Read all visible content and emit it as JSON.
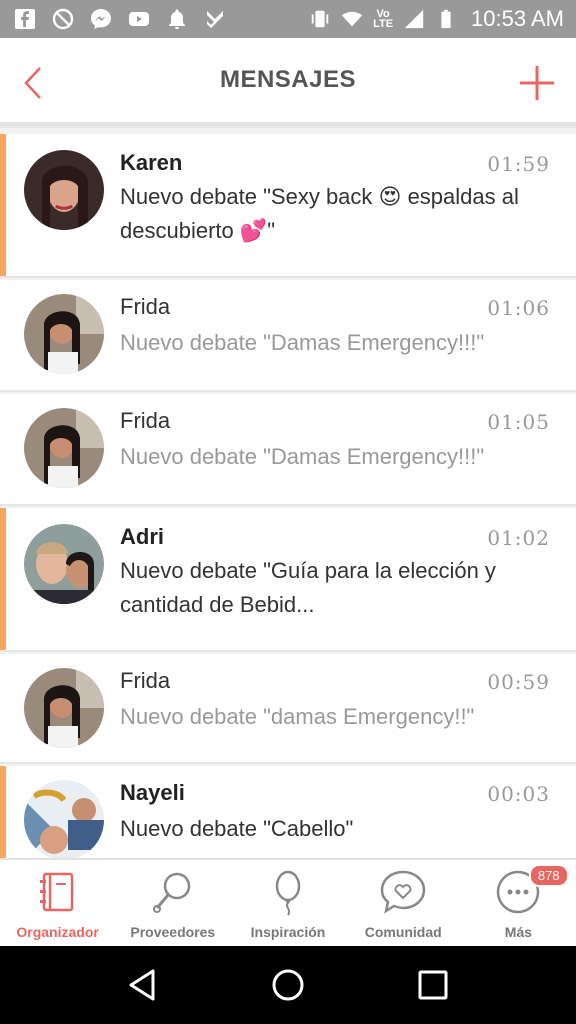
{
  "status_bar": {
    "time": "10:53 AM",
    "volte_top": "Vo",
    "volte_bottom": "LTE",
    "icons": [
      "facebook-icon",
      "blocked-icon",
      "messenger-icon",
      "youtube-icon",
      "bell-icon",
      "check-icon",
      "vibrate-icon",
      "wifi-icon",
      "volte-icon",
      "signal-icon",
      "battery-icon"
    ]
  },
  "header": {
    "title": "MENSAJES",
    "back_icon": "chevron-left-icon",
    "add_icon": "plus-icon",
    "accent_color": "#e9655f"
  },
  "messages": [
    {
      "name": "Karen",
      "time": "01:59",
      "text": "Nuevo debate \"Sexy back 😍 espaldas al descubierto 💕\"",
      "unread": true
    },
    {
      "name": "Frida",
      "time": "01:06",
      "text": "Nuevo debate \"Damas Emergency!!!\"",
      "unread": false
    },
    {
      "name": "Frida",
      "time": "01:05",
      "text": "Nuevo debate \"Damas Emergency!!!\"",
      "unread": false
    },
    {
      "name": "Adri",
      "time": "01:02",
      "text": "Nuevo debate \"Guía para la elección y cantidad de Bebid...",
      "unread": true
    },
    {
      "name": "Frida",
      "time": "00:59",
      "text": "Nuevo debate \"damas Emergency!!\"",
      "unread": false
    },
    {
      "name": "Nayeli",
      "time": "00:03",
      "text": "Nuevo debate \"Cabello\"",
      "unread": true
    }
  ],
  "unread_indicator_color": "#f5a75a",
  "tabs": [
    {
      "label": "Organizador",
      "icon": "notebook-icon",
      "active": true
    },
    {
      "label": "Proveedores",
      "icon": "magnifier-icon",
      "active": false
    },
    {
      "label": "Inspiración",
      "icon": "balloon-icon",
      "active": false
    },
    {
      "label": "Comunidad",
      "icon": "chat-heart-icon",
      "active": false
    },
    {
      "label": "Más",
      "icon": "more-icon",
      "active": false,
      "badge": "878"
    }
  ],
  "nav": {
    "icons": [
      "back-triangle-icon",
      "home-circle-icon",
      "recents-square-icon"
    ]
  }
}
